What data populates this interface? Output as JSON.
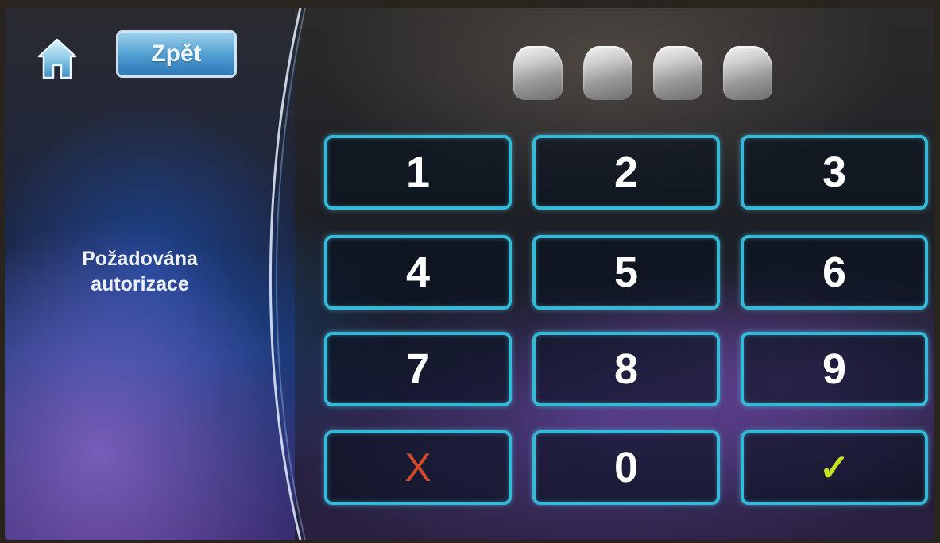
{
  "header": {
    "home_icon": "home-icon",
    "back_label": "Zpět"
  },
  "status": {
    "line1": "Požadována",
    "line2": "autorizace"
  },
  "pin": {
    "length": 4,
    "entered": 0
  },
  "keypad": {
    "keys": [
      {
        "label": "1",
        "name": "key-1"
      },
      {
        "label": "2",
        "name": "key-2"
      },
      {
        "label": "3",
        "name": "key-3"
      },
      {
        "label": "4",
        "name": "key-4"
      },
      {
        "label": "5",
        "name": "key-5"
      },
      {
        "label": "6",
        "name": "key-6"
      },
      {
        "label": "7",
        "name": "key-7"
      },
      {
        "label": "8",
        "name": "key-8"
      },
      {
        "label": "9",
        "name": "key-9"
      },
      {
        "label": "X",
        "name": "cancel-button"
      },
      {
        "label": "0",
        "name": "key-0"
      },
      {
        "label": "✓",
        "name": "confirm-button"
      }
    ]
  },
  "colors": {
    "key_border": "#35b9d8",
    "cancel": "#d24a2a",
    "confirm": "#c4e01e",
    "back_button": "#4d9cd0"
  }
}
